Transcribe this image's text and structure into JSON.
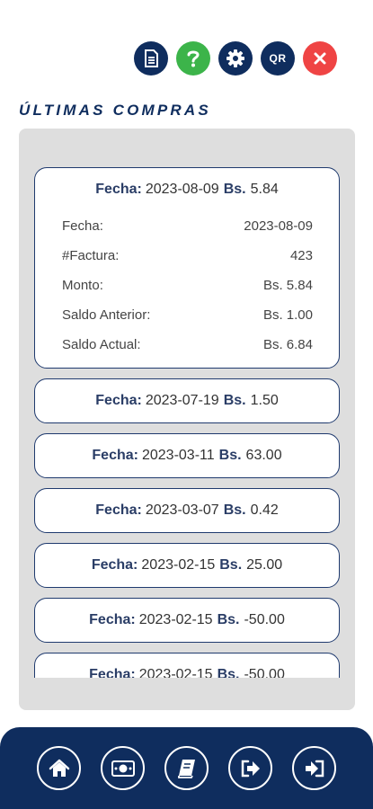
{
  "toolbar": {
    "icons": [
      "document-icon",
      "help-icon",
      "settings-icon",
      "qr-icon",
      "close-icon"
    ],
    "qr_label": "QR"
  },
  "section_title": "ÚLTIMAS COMPRAS",
  "labels": {
    "fecha": "Fecha:",
    "bs": "Bs."
  },
  "expanded": {
    "date": "2023-08-09",
    "amount": "5.84",
    "details": [
      {
        "label": "Fecha:",
        "value": "2023-08-09"
      },
      {
        "label": "#Factura:",
        "value": "423"
      },
      {
        "label": "Monto:",
        "value": "Bs. 5.84"
      },
      {
        "label": "Saldo Anterior:",
        "value": "Bs. 1.00"
      },
      {
        "label": "Saldo Actual:",
        "value": "Bs. 6.84"
      }
    ]
  },
  "purchases": [
    {
      "date": "2023-07-19",
      "amount": "1.50"
    },
    {
      "date": "2023-03-11",
      "amount": "63.00"
    },
    {
      "date": "2023-03-07",
      "amount": "0.42"
    },
    {
      "date": "2023-02-15",
      "amount": "25.00"
    },
    {
      "date": "2023-02-15",
      "amount": "-50.00"
    },
    {
      "date": "2023-02-15",
      "amount": "-50.00"
    }
  ],
  "bottom_nav": {
    "icons": [
      "home-icon",
      "money-icon",
      "book-icon",
      "share-out-icon",
      "sign-in-icon"
    ]
  },
  "colors": {
    "navy": "#0f2d5e",
    "green": "#3cb44a",
    "red": "#ef4444",
    "panel": "#dedede"
  }
}
